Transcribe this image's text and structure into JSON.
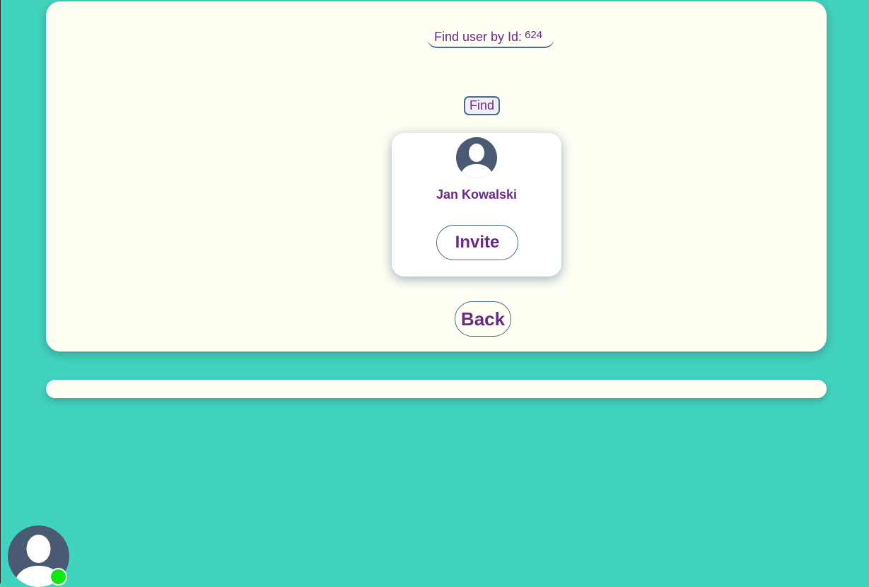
{
  "search": {
    "label": "Find user by Id:",
    "id_value": "624",
    "find_label": "Find"
  },
  "result": {
    "name": "Jan Kowalski",
    "invite_label": "Invite"
  },
  "nav": {
    "back_label": "Back"
  },
  "status": {
    "online_color": "#11e611"
  },
  "icons": {
    "avatar": "user-silhouette-icon"
  },
  "colors": {
    "background": "#42d3be",
    "panel": "#fffff4",
    "text": "#6b2a8a",
    "border": "#4a6a90",
    "avatar": "#4a5a72"
  }
}
